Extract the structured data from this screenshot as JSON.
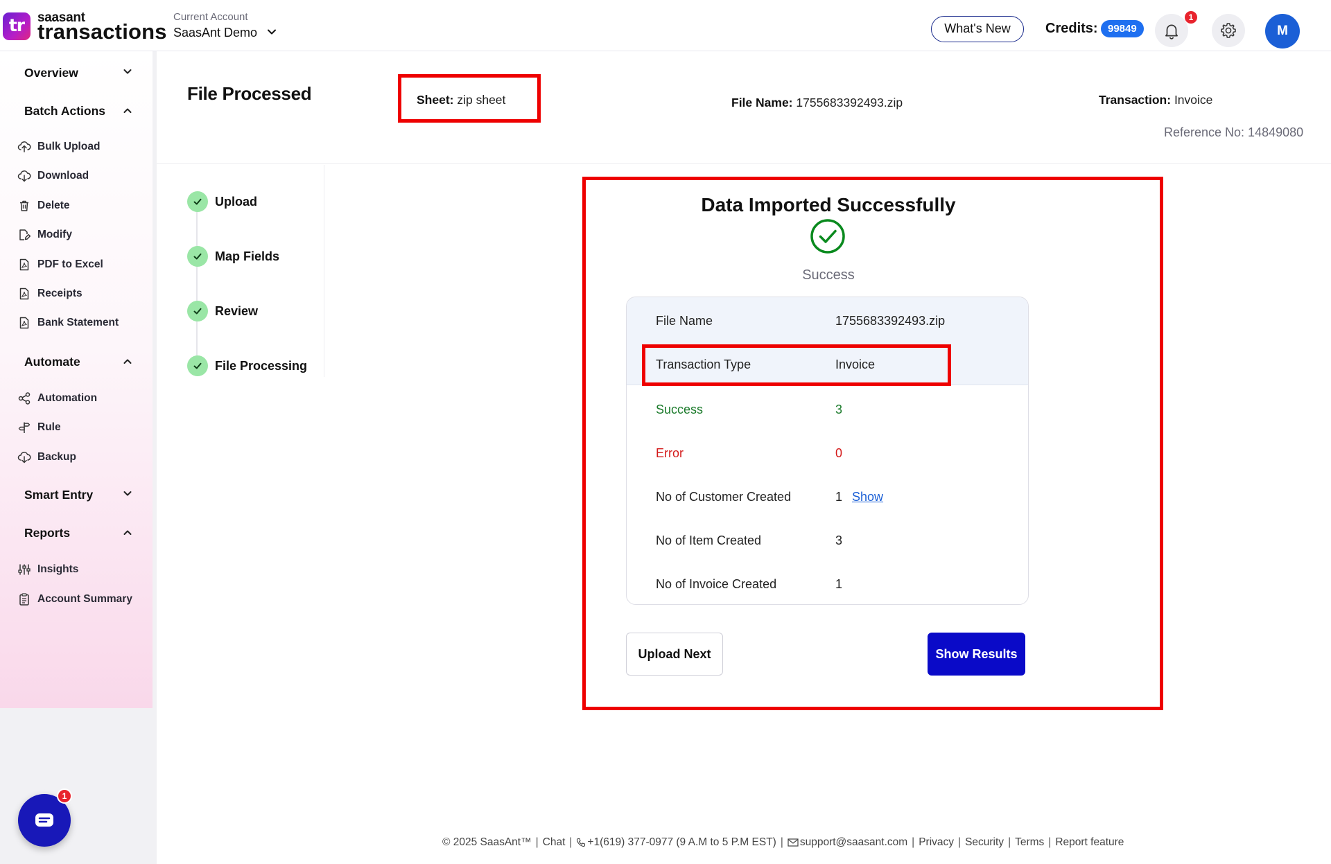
{
  "brand": {
    "logo_mark": "tr",
    "logo_small": "saasant",
    "logo_big": "transactions",
    "gradient_colors": [
      "#6a1fd1",
      "#b51ec8",
      "#e0267f"
    ]
  },
  "account": {
    "label": "Current Account",
    "name": "SaasAnt Demo"
  },
  "header": {
    "whats_new": "What's New",
    "credits_label": "Credits:",
    "credits_value": "99849",
    "notification_count": "1",
    "avatar_initial": "M"
  },
  "sidebar": {
    "overview": "Overview",
    "batch_actions": {
      "label": "Batch Actions",
      "items": [
        {
          "label": "Bulk Upload",
          "icon": "cloud-upload-icon"
        },
        {
          "label": "Download",
          "icon": "cloud-download-icon"
        },
        {
          "label": "Delete",
          "icon": "trash-icon"
        },
        {
          "label": "Modify",
          "icon": "edit-file-icon"
        },
        {
          "label": "PDF to Excel",
          "icon": "pdf-file-icon"
        },
        {
          "label": "Receipts",
          "icon": "receipt-file-icon"
        },
        {
          "label": "Bank Statement",
          "icon": "bank-file-icon"
        }
      ]
    },
    "automate": {
      "label": "Automate",
      "items": [
        {
          "label": "Automation",
          "icon": "share-nodes-icon"
        },
        {
          "label": "Rule",
          "icon": "signpost-icon"
        },
        {
          "label": "Backup",
          "icon": "cloud-backup-icon"
        }
      ]
    },
    "smart_entry": "Smart Entry",
    "reports": {
      "label": "Reports",
      "items": [
        {
          "label": "Insights",
          "icon": "sliders-icon"
        },
        {
          "label": "Account Summary",
          "icon": "clipboard-icon"
        }
      ]
    },
    "chat_badge": "1"
  },
  "page": {
    "title": "File Processed",
    "sheet_label": "Sheet:",
    "sheet_value": "zip sheet",
    "file_name_label": "File Name:",
    "file_name_value": "1755683392493.zip",
    "transaction_label": "Transaction:",
    "transaction_value": "Invoice",
    "reference": "Reference No: 14849080"
  },
  "steps": [
    {
      "label": "Upload"
    },
    {
      "label": "Map Fields"
    },
    {
      "label": "Review"
    },
    {
      "label": "File Processing"
    }
  ],
  "result": {
    "title": "Data Imported Successfully",
    "status": "Success",
    "rows": [
      {
        "label": "File Name",
        "value": "1755683392493.zip"
      },
      {
        "label": "Transaction Type",
        "value": "Invoice"
      },
      {
        "label": "Success",
        "value": "3"
      },
      {
        "label": "Error",
        "value": "0"
      },
      {
        "label": "No of Customer Created",
        "value": "1",
        "link": "Show"
      },
      {
        "label": "No of Item Created",
        "value": "3"
      },
      {
        "label": "No of Invoice Created",
        "value": "1"
      }
    ],
    "upload_next": "Upload Next",
    "show_results": "Show Results"
  },
  "footer": {
    "copyright": "© 2025 SaasAnt™",
    "chat": "Chat",
    "phone": "+1(619) 377-0977 (9 A.M to 5 P.M EST)",
    "email": "support@saasant.com",
    "privacy": "Privacy",
    "security": "Security",
    "terms": "Terms",
    "report_feature": "Report feature"
  },
  "colors": {
    "accent_blue": "#0a0ac8",
    "credits_blue": "#1e6ff0",
    "highlight_red": "#ee0000",
    "success_green": "#1a7a2a",
    "error_red": "#d41a1a",
    "step_green": "#9ae6a6"
  }
}
